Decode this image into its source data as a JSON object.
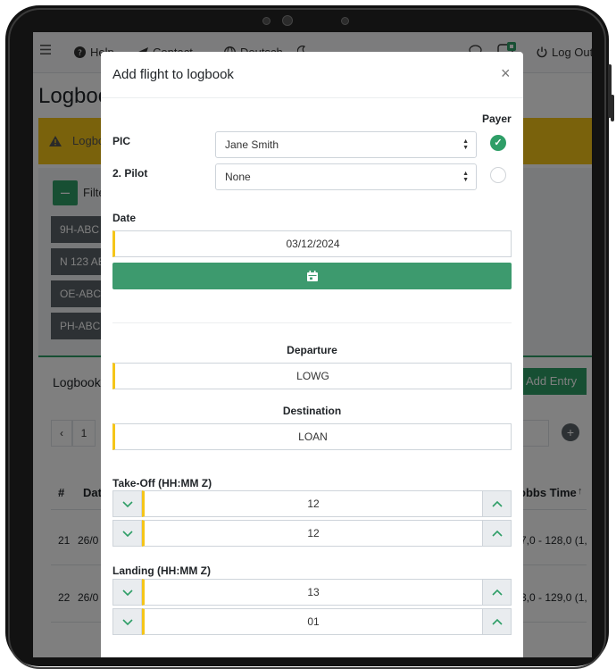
{
  "nav": {
    "help": "Help",
    "contact": "Contact",
    "language": "Deutsch",
    "logout": "Log Out"
  },
  "app": {
    "title": "Logboo",
    "warning_text": "Logbo",
    "filter_label": "Filte",
    "filter_chips": [
      "9H-ABC |",
      "N 123 AB",
      "OE-ABCD",
      "PH-ABC |"
    ],
    "logbook_title": "Logbook",
    "add_entry_label": "Add Entry",
    "pager_page": "1",
    "table": {
      "headers": [
        "#",
        "Dat",
        "obbs Time"
      ],
      "rows": [
        {
          "num": "21",
          "date": "26/0",
          "hobbs": "7,0 - 128,0 (1,"
        },
        {
          "num": "22",
          "date": "26/0",
          "hobbs": "3,0 - 129,0 (1,"
        }
      ]
    }
  },
  "modal": {
    "title": "Add flight to logbook",
    "payer_label": "Payer",
    "pic_label": "PIC",
    "pic_value": "Jane Smith",
    "pilot2_label": "2. Pilot",
    "pilot2_value": "None",
    "date_label": "Date",
    "date_value": "03/12/2024",
    "departure_label": "Departure",
    "departure_value": "LOWG",
    "destination_label": "Destination",
    "destination_value": "LOAN",
    "takeoff_label": "Take-Off (HH:MM Z)",
    "takeoff_hour": "12",
    "takeoff_minute": "12",
    "landing_label": "Landing (HH:MM Z)",
    "landing_hour": "13",
    "landing_minute": "01"
  },
  "colors": {
    "accent_green": "#2e9e67",
    "warning_yellow": "#f5c518",
    "overlay": "rgba(0,0,0,0.5)"
  },
  "icons": [
    "menu-icon",
    "help-icon",
    "send-icon",
    "globe-icon",
    "moon-icon",
    "chat-icon",
    "aircraft-badge-icon",
    "power-icon",
    "close-icon",
    "check-icon",
    "calendar-icon",
    "chevron-down-icon",
    "chevron-up-icon",
    "warning-icon",
    "plus-icon"
  ]
}
